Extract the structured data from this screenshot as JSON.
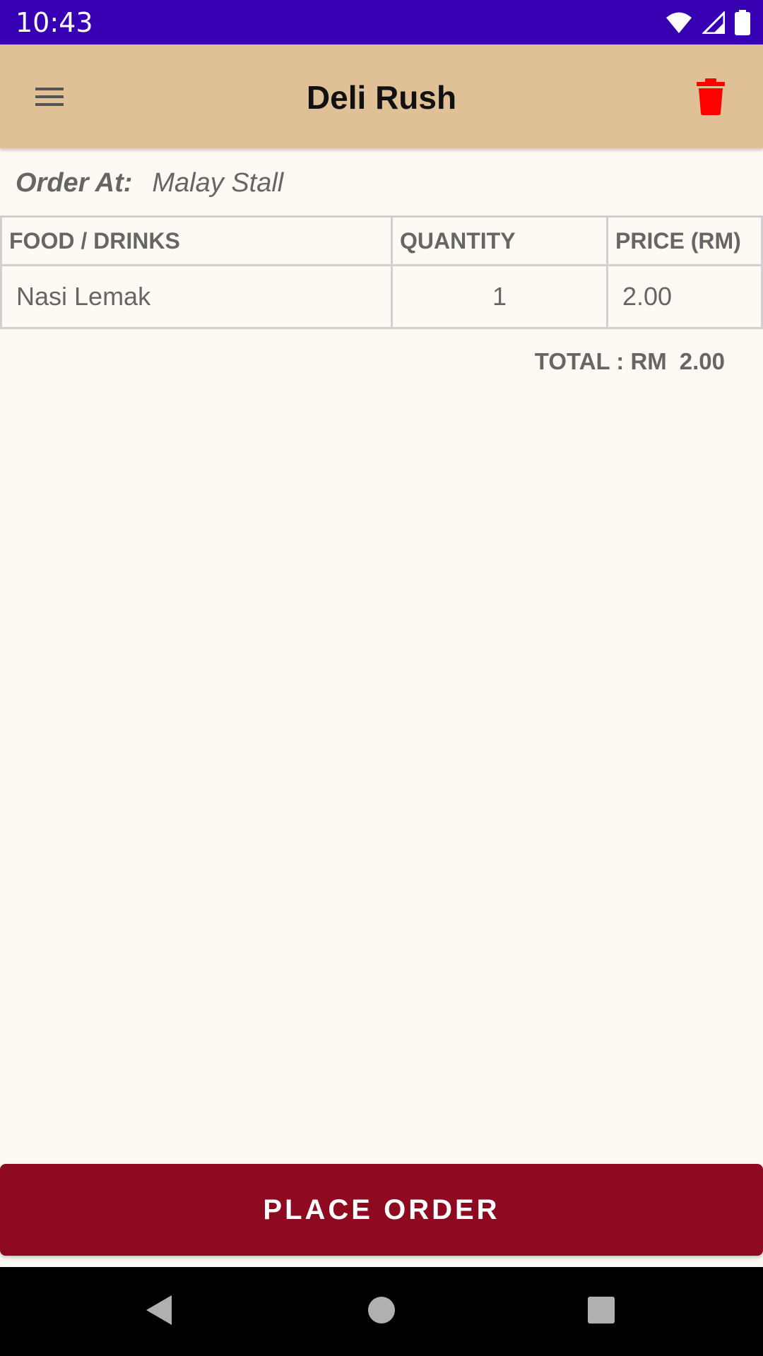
{
  "status_bar": {
    "time": "10:43",
    "icons": [
      "wifi-icon",
      "cellular-signal-icon",
      "battery-icon"
    ]
  },
  "app_bar": {
    "title": "Deli Rush",
    "menu_icon": "hamburger-menu-icon",
    "delete_icon": "trash-icon"
  },
  "order": {
    "label": "Order At:",
    "stall": "Malay Stall"
  },
  "table": {
    "headers": [
      "FOOD / DRINKS",
      "QUANTITY",
      "PRICE (RM)"
    ],
    "rows": [
      {
        "item": "Nasi Lemak",
        "quantity": "1",
        "price": "2.00"
      }
    ]
  },
  "total": {
    "label": "TOTAL : RM",
    "amount": "2.00"
  },
  "place_order_label": "PLACE ORDER",
  "nav_bar": {
    "buttons": [
      "back-icon",
      "home-icon",
      "recents-icon"
    ]
  },
  "colors": {
    "status_bar": "#3700B3",
    "app_bar": "#E0C097",
    "background": "#FFF9F4",
    "button": "#8E0A20",
    "delete_icon": "#FF0000"
  }
}
